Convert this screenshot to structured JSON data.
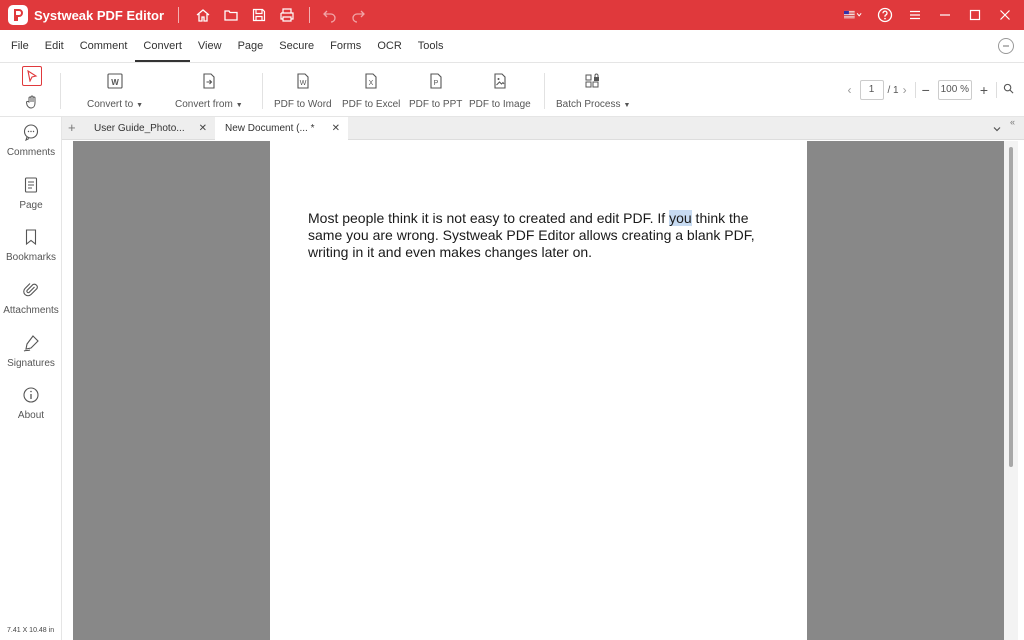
{
  "titlebar": {
    "app_title": "Systweak PDF Editor",
    "icons": [
      "home-icon",
      "folder-icon",
      "save-icon",
      "print-icon",
      "undo-icon",
      "redo-icon"
    ],
    "right_icons": [
      "flag-us-icon",
      "help-icon",
      "hamburger-menu-icon",
      "minimize-icon",
      "maximize-icon",
      "close-icon"
    ]
  },
  "menu": {
    "items": [
      "File",
      "Edit",
      "Comment",
      "Convert",
      "View",
      "Page",
      "Secure",
      "Forms",
      "OCR",
      "Tools"
    ],
    "active": "Convert"
  },
  "toolbar": {
    "convert_to": "Convert to",
    "convert_from": "Convert from",
    "pdf_to_word": "PDF to Word",
    "pdf_to_excel": "PDF to Excel",
    "pdf_to_ppt": "PDF to PPT",
    "pdf_to_image": "PDF to Image",
    "batch_process": "Batch Process"
  },
  "pager": {
    "current_page": "1",
    "total_pages": "/ 1",
    "zoom": "100 %"
  },
  "sidebar": {
    "items": [
      {
        "label": "Comments",
        "icon": "comments-icon"
      },
      {
        "label": "Page",
        "icon": "page-icon"
      },
      {
        "label": "Bookmarks",
        "icon": "bookmark-icon"
      },
      {
        "label": "Attachments",
        "icon": "paperclip-icon"
      },
      {
        "label": "Signatures",
        "icon": "pen-icon"
      },
      {
        "label": "About",
        "icon": "info-icon"
      }
    ],
    "page_size": "7.41 X 10.48 in"
  },
  "tabs": [
    {
      "label": "User Guide_Photo...",
      "active": false
    },
    {
      "label": "New Document (... *",
      "active": true
    }
  ],
  "document": {
    "text_before": "Most people think it is not easy to created and edit PDF. If ",
    "text_highlight": "you",
    "text_after": " think the same you are wrong. Systweak PDF Editor allows creating a blank PDF, writing in it and even makes changes later on."
  },
  "colors": {
    "accent": "#e0393c",
    "viewer_bg": "#888888",
    "highlight": "#c7dbf2"
  }
}
